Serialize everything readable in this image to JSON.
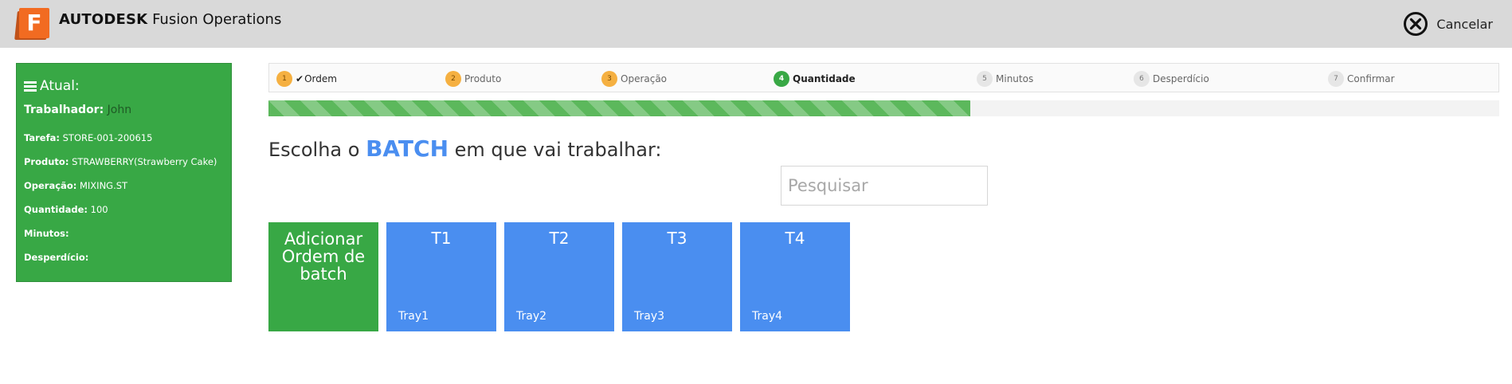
{
  "app": {
    "brand_bold": "AUTODESK",
    "brand_rest": "Fusion Operations",
    "logo_letter": "F",
    "cancel_label": "Cancelar"
  },
  "sidebar": {
    "title": "Atual:",
    "worker_label": "Trabalhador:",
    "worker_value": "John",
    "rows": [
      {
        "label": "Tarefa:",
        "value": "STORE-001-200615"
      },
      {
        "label": "Produto:",
        "value": "STRAWBERRY(Strawberry Cake)"
      },
      {
        "label": "Operação:",
        "value": "MIXING.ST"
      },
      {
        "label": "Quantidade:",
        "value": "100"
      },
      {
        "label": "Minutos:",
        "value": ""
      },
      {
        "label": "Desperdício:",
        "value": ""
      }
    ]
  },
  "steps": [
    {
      "num": "1",
      "label": "Ordem",
      "state": "done"
    },
    {
      "num": "2",
      "label": "Produto",
      "state": "done"
    },
    {
      "num": "3",
      "label": "Operação",
      "state": "done"
    },
    {
      "num": "4",
      "label": "Quantidade",
      "state": "active"
    },
    {
      "num": "5",
      "label": "Minutos",
      "state": "pending"
    },
    {
      "num": "6",
      "label": "Desperdício",
      "state": "pending"
    },
    {
      "num": "7",
      "label": "Confirmar",
      "state": "pending"
    }
  ],
  "progress": {
    "percent": 57
  },
  "heading": {
    "prefix": "Escolha o",
    "accent": "BATCH",
    "suffix": "em que vai trabalhar:"
  },
  "search": {
    "placeholder": "Pesquisar",
    "value": ""
  },
  "add_tile": {
    "label": "Adicionar Ordem de batch"
  },
  "batches": [
    {
      "title": "T1",
      "subtitle": "Tray1"
    },
    {
      "title": "T2",
      "subtitle": "Tray2"
    },
    {
      "title": "T3",
      "subtitle": "Tray3"
    },
    {
      "title": "T4",
      "subtitle": "Tray4"
    }
  ],
  "colors": {
    "green": "#38a845",
    "blue": "#4a8ef0",
    "orange": "#f5b041",
    "header_bg": "#d9d9d9"
  }
}
